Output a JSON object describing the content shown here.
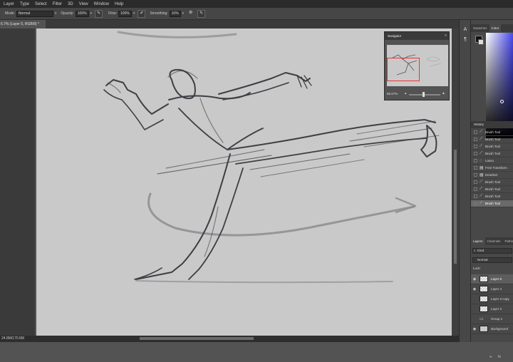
{
  "menu": [
    "Layer",
    "Type",
    "Select",
    "Filter",
    "3D",
    "View",
    "Window",
    "Help"
  ],
  "options": {
    "mode_label": "Mode:",
    "mode_value": "Normal",
    "opacity_label": "Opacity:",
    "opacity_value": "100%",
    "flow_label": "Flow:",
    "flow_value": "100%",
    "smoothing_label": "Smoothing:",
    "smoothing_value": "10%"
  },
  "document": {
    "tab_title": "6.7% (Layer 5, RGB/8) *",
    "status_text": "24.8M/170.6M"
  },
  "navigator": {
    "title": "Navigator",
    "zoom": "66.67%"
  },
  "color_panel": {
    "tabs": [
      "Swatches",
      "Color"
    ],
    "active_tab": "Color"
  },
  "history": {
    "title": "History",
    "items": [
      "Brush Tool",
      "Brush Tool",
      "Brush Tool",
      "Brush Tool",
      "Lasso",
      "Free Transform",
      "Deselect",
      "Brush Tool",
      "Brush Tool",
      "Brush Tool",
      "Brush Tool"
    ],
    "selected_index": 10
  },
  "layers": {
    "tabs": [
      "Layers",
      "Channels",
      "Paths"
    ],
    "kind_filter": "Kind",
    "blend_mode": "Normal",
    "lock_label": "Lock:",
    "items": [
      "Layer 5",
      "Layer 4",
      "Layer 3 copy",
      "Layer 3",
      "Group 1",
      "Background"
    ],
    "selected_index": 0,
    "footer": "fx"
  },
  "icons": {
    "brush_pressure": "pen-pressure-icon",
    "airbrush": "airbrush-icon",
    "settings": "gear-icon",
    "symmetry": "butterfly-icon"
  }
}
